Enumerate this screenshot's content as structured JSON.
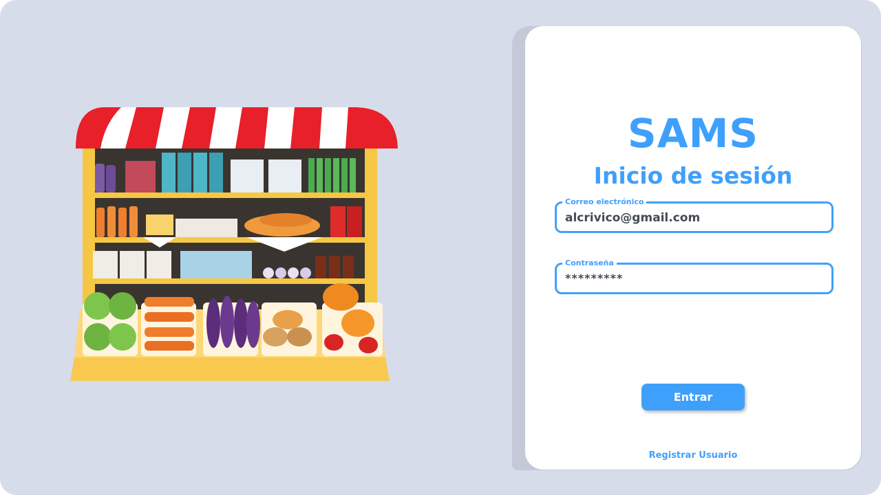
{
  "brand": {
    "name": "SAMS",
    "subtitle": "Inicio de sesión"
  },
  "form": {
    "email": {
      "label": "Correo electrónico",
      "value": "alcrivico@gmail.com"
    },
    "password": {
      "label": "Contraseña",
      "value": "*********"
    },
    "submit_label": "Entrar",
    "register_link": "Registrar Usuario"
  },
  "colors": {
    "background": "#d7dcea",
    "accent": "#3fa0fb",
    "card": "#ffffff",
    "awning_red": "#e8202a",
    "shelf_yellow": "#f6c744"
  },
  "illustration": {
    "icon": "grocery-store-stall-icon"
  }
}
